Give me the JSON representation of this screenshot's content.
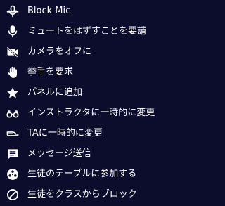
{
  "menu": {
    "items": [
      {
        "label": "Block Mic",
        "icon": "block-mic-icon"
      },
      {
        "label": "ミュートをはずすことを要請",
        "icon": "microphone-icon"
      },
      {
        "label": "カメラをオフに",
        "icon": "camera-off-icon"
      },
      {
        "label": "挙手を要求",
        "icon": "raise-hand-icon"
      },
      {
        "label": "パネルに追加",
        "icon": "star-icon"
      },
      {
        "label": "インストラクタに一時的に変更",
        "icon": "glasses-icon"
      },
      {
        "label": "TAに一時的に変更",
        "icon": "ta-hat-icon"
      },
      {
        "label": "メッセージ送信",
        "icon": "message-icon"
      },
      {
        "label": "生徒のテーブルに参加する",
        "icon": "join-table-icon"
      },
      {
        "label": "生徒をクラスからブロック",
        "icon": "block-icon"
      }
    ]
  },
  "colors": {
    "background": "#0c0c2c",
    "text": "#ffffff",
    "icon": "#ffffff"
  }
}
